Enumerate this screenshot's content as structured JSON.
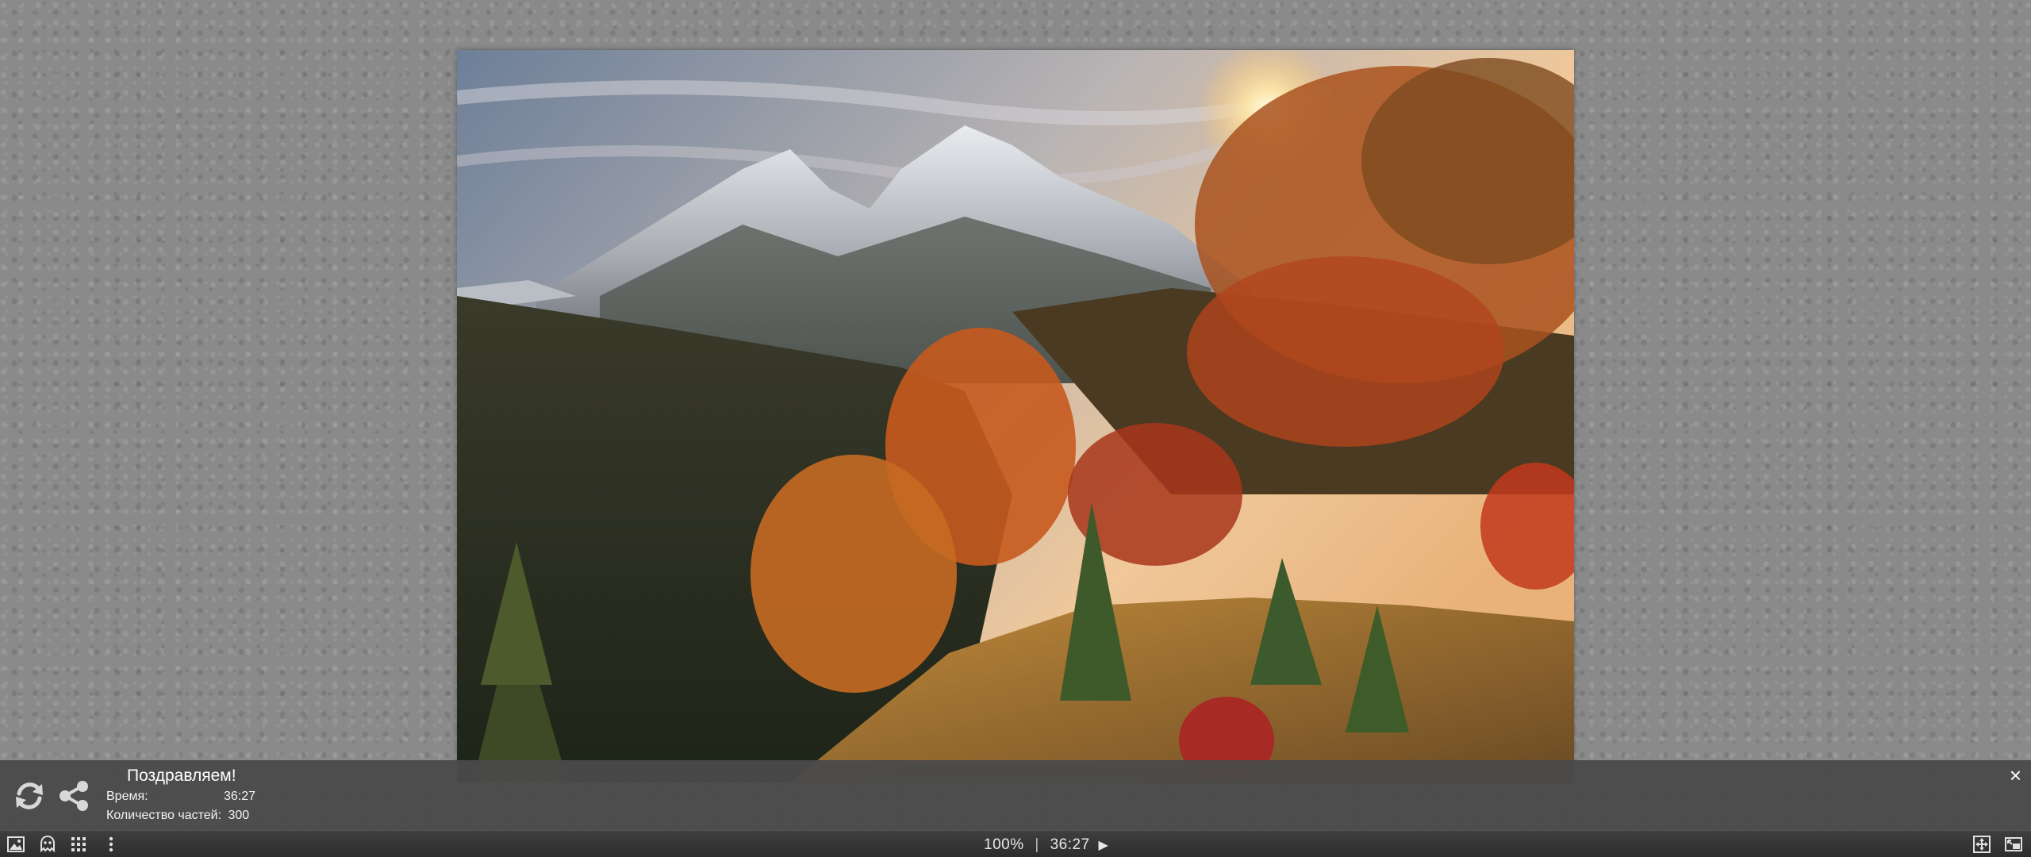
{
  "congrats": {
    "title": "Поздравляем!",
    "time_label": "Время:",
    "time_value": "36:27",
    "pieces_label": "Количество частей:",
    "pieces_value": "300",
    "close_label": "×"
  },
  "toolbar": {
    "zoom": "100%",
    "separator": "|",
    "timer": "36:27",
    "play_symbol": "▶",
    "left_icons": [
      "image-preview-icon",
      "ghost-image-icon",
      "piece-grid-icon",
      "more-menu-icon"
    ],
    "right_icons": [
      "fullscreen-icon",
      "window-icon"
    ]
  },
  "colors": {
    "panel": "#4a4a4a",
    "toolbar": "#333333",
    "background": "#8a8a8a"
  }
}
